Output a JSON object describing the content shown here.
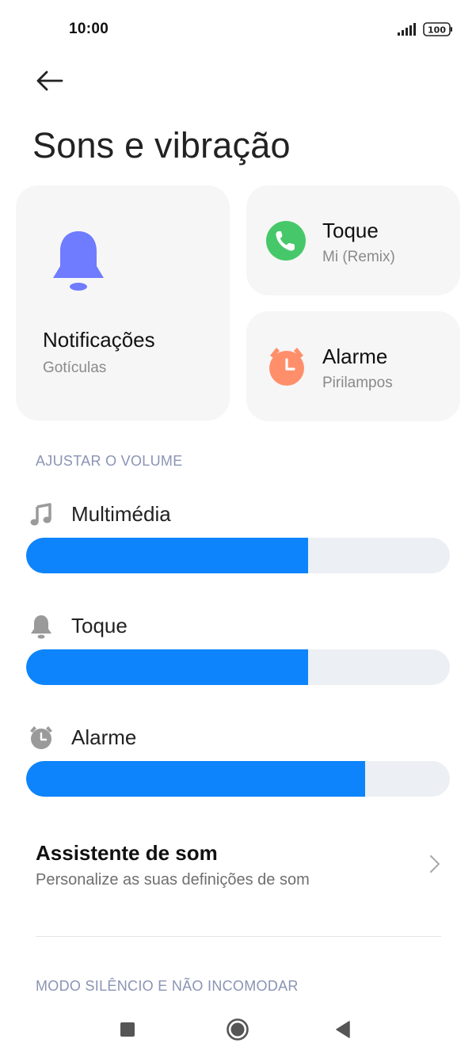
{
  "status_bar": {
    "time": "10:00",
    "battery": "100"
  },
  "header": {
    "title": "Sons e vibração"
  },
  "cards": {
    "notifications": {
      "title": "Notificações",
      "subtitle": "Gotículas",
      "icon": "bell-icon",
      "color": "#6f7cff"
    },
    "ringtone": {
      "title": "Toque",
      "subtitle": "Mi (Remix)",
      "icon": "phone-icon",
      "color": "#46c86a"
    },
    "alarm": {
      "title": "Alarme",
      "subtitle": "Pirilampos",
      "icon": "alarm-clock-icon",
      "color": "#ff8f6b"
    }
  },
  "volume": {
    "section_label": "AJUSTAR O VOLUME",
    "sliders": [
      {
        "label": "Multimédia",
        "icon": "music-note-icon",
        "level": 0.665
      },
      {
        "label": "Toque",
        "icon": "bell-icon",
        "level": 0.665
      },
      {
        "label": "Alarme",
        "icon": "alarm-clock-icon",
        "level": 0.8
      }
    ],
    "accent_color": "#0d84fb"
  },
  "assistant": {
    "title": "Assistente de som",
    "subtitle": "Personalize as suas definições de som"
  },
  "silent_section": {
    "label": "MODO SILÊNCIO E NÃO INCOMODAR"
  },
  "navbar": {
    "buttons": [
      "recents-square-icon",
      "home-circle-icon",
      "back-triangle-icon"
    ]
  }
}
